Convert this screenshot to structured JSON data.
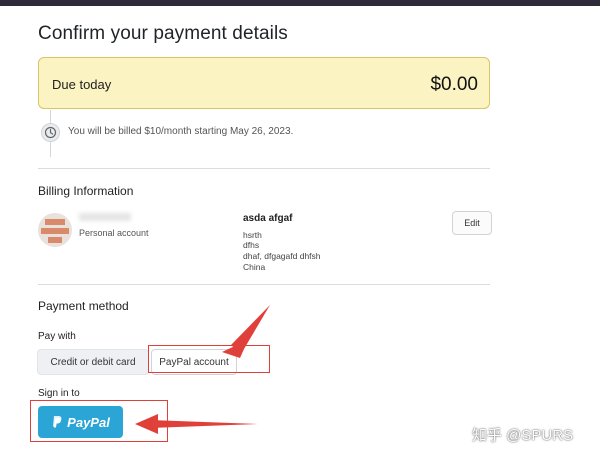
{
  "page_title": "Confirm your payment details",
  "due": {
    "label": "Due today",
    "amount": "$0.00"
  },
  "billing_note": "You will be billed $10/month starting May 26, 2023.",
  "billing_info": {
    "section_title": "Billing Information",
    "account_type": "Personal account",
    "name": "asda afgaf",
    "address_lines": [
      "hsrth",
      "dfhs",
      "dhaf, dfgagafd dhfsh",
      "China"
    ],
    "edit_label": "Edit"
  },
  "payment_method": {
    "section_title": "Payment method",
    "pay_with_label": "Pay with",
    "tabs": [
      "Credit or debit card",
      "PayPal account"
    ],
    "selected_tab": "PayPal account",
    "sign_in_label": "Sign in to",
    "paypal_button_text": "PayPal"
  },
  "watermark": "知乎 @SPURS",
  "colors": {
    "due_bg": "#fbf3c2",
    "due_border": "#d9c565",
    "paypal_blue": "#2aa5d6",
    "annotation_red": "#e0403a"
  }
}
